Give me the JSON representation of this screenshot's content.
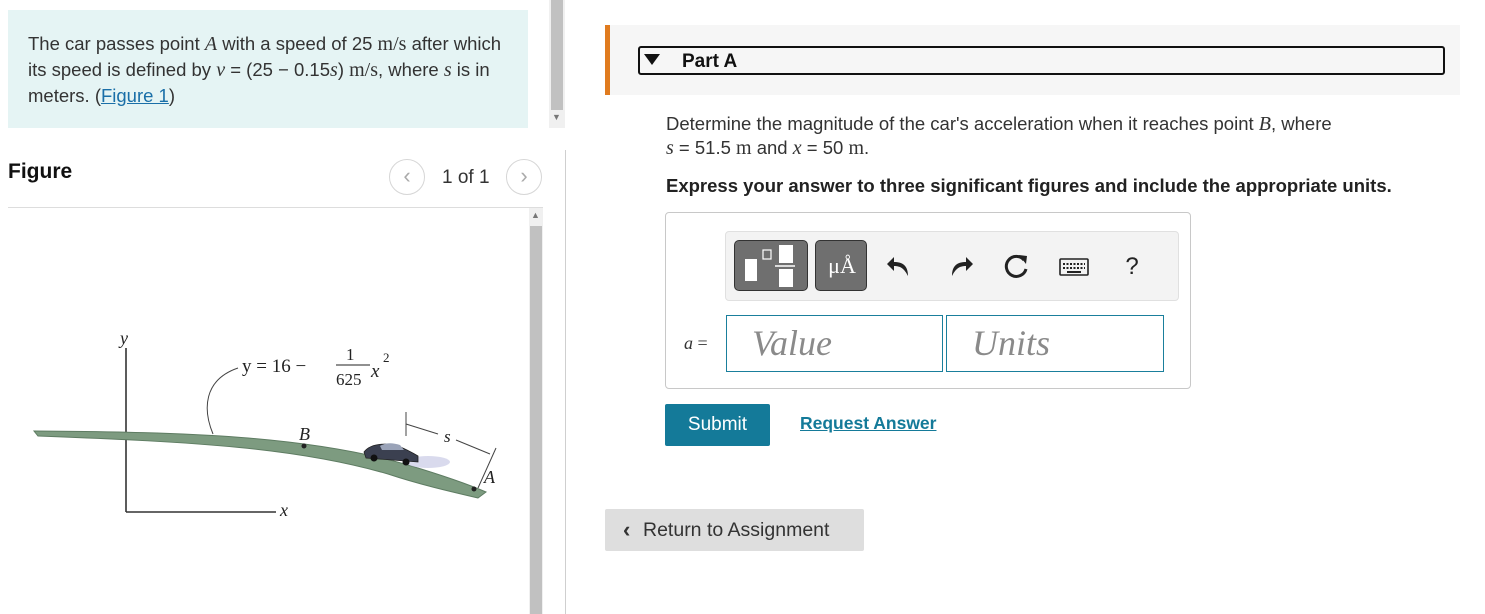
{
  "problem": {
    "text_1": "The car passes point ",
    "point_a": "A",
    "text_2": " with a speed of 25 ",
    "unit_ms_1": "m/s",
    "text_3": " after which its speed is defined by ",
    "var_v": "v",
    "text_4": " = (25 − 0.15",
    "var_s": "s",
    "text_5": ") ",
    "unit_ms_2": "m/s",
    "text_6": ", where ",
    "var_s2": "s",
    "text_7": " is in meters. (",
    "figure_link": "Figure 1",
    "text_8": ")"
  },
  "figure_panel": {
    "title": "Figure",
    "prev_icon": "chevron-left-icon",
    "next_icon": "chevron-right-icon",
    "counter": "1 of 1"
  },
  "diagram": {
    "y_axis_label": "y",
    "x_axis_label": "x",
    "equation_prefix": "y = 16 −",
    "fraction_num": "1",
    "fraction_den": "625",
    "equation_suffix": "x",
    "exponent": "2",
    "point_b": "B",
    "point_a": "A",
    "distance_label": "s",
    "road_color": "#7d9b80"
  },
  "part": {
    "title": "Part A",
    "caret_icon": "caret-down-icon",
    "accent_color": "#e07b1f"
  },
  "question": {
    "text_1": "Determine the magnitude of the car's acceleration when it reaches point ",
    "point_b": "B",
    "text_2": ", where ",
    "var_s": "s",
    "text_3": " = 51.5 ",
    "unit_m_1": "m",
    "text_4": " and ",
    "var_x": "x",
    "text_5": " = 50 ",
    "unit_m_2": "m",
    "text_6": "."
  },
  "instruction": "Express your answer to three significant figures and include the appropriate units.",
  "toolbar": {
    "templates_icon": "templates-icon",
    "units_button_label": "μÅ",
    "undo_icon": "undo-icon",
    "redo_icon": "redo-icon",
    "reset_icon": "reset-icon",
    "keyboard_icon": "keyboard-icon",
    "help_label": "?"
  },
  "answer": {
    "label_var": "a",
    "label_eq": " =",
    "value_placeholder": "Value",
    "units_placeholder": "Units"
  },
  "actions": {
    "submit_label": "Submit",
    "request_label": "Request Answer",
    "return_label": "Return to Assignment",
    "submit_color": "#147a99"
  }
}
